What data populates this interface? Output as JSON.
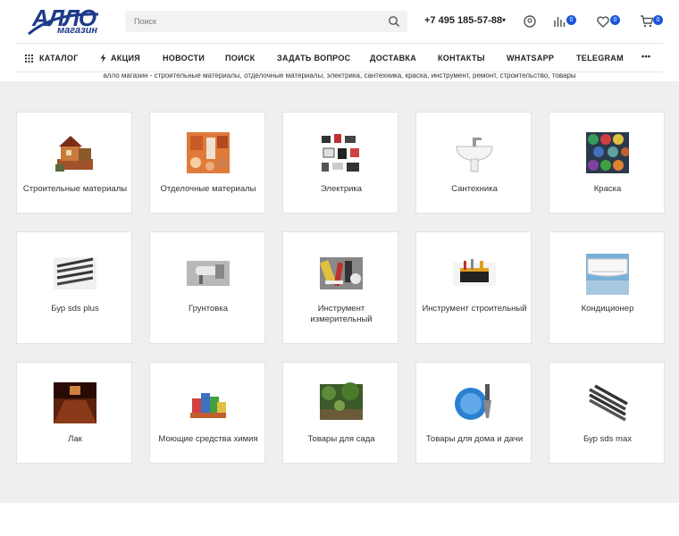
{
  "header": {
    "logo_main": "АЛЛО",
    "logo_sub": "магазин",
    "search_placeholder": "Поиск",
    "phone": "+7 495 185-57-88",
    "compare_count": "0",
    "favorites_count": "0",
    "cart_count": "0"
  },
  "nav": {
    "items": [
      "КАТАЛОГ",
      "АКЦИЯ",
      "НОВОСТИ",
      "ПОИСК",
      "ЗАДАТЬ ВОПРОС",
      "ДОСТАВКА",
      "КОНТАКТЫ",
      "WHATSAPP",
      "TELEGRAM"
    ],
    "more": "•••"
  },
  "tagline": "алло магазин - строительные материалы, отделочные материалы, электрика, сантехника, краска, инструмент, ремонт, строительство, товары",
  "categories": [
    {
      "label": "Строительные материалы",
      "icon": "house-icon"
    },
    {
      "label": "Отделочные материалы",
      "icon": "tiles-icon"
    },
    {
      "label": "Электрика",
      "icon": "electrical-icon"
    },
    {
      "label": "Сантехника",
      "icon": "sink-icon"
    },
    {
      "label": "Краска",
      "icon": "paint-cans-icon"
    },
    {
      "label": "Бур sds plus",
      "icon": "drill-bits-icon"
    },
    {
      "label": "Грунтовка",
      "icon": "primer-icon"
    },
    {
      "label": "Инструмент измерительный",
      "icon": "measuring-tools-icon"
    },
    {
      "label": "Инструмент строительный",
      "icon": "tool-bag-icon"
    },
    {
      "label": "Кондиционер",
      "icon": "air-conditioner-icon"
    },
    {
      "label": "Лак",
      "icon": "varnish-floor-icon"
    },
    {
      "label": "Моющие средства химия",
      "icon": "detergents-icon"
    },
    {
      "label": "Товары для сада",
      "icon": "garden-icon"
    },
    {
      "label": "Товары для дома и дачи",
      "icon": "dishes-icon"
    },
    {
      "label": "Бур sds max",
      "icon": "drill-bits-max-icon"
    }
  ],
  "colors": {
    "brand": "#1e3a8a",
    "badge": "#1a56db",
    "background": "#efefef"
  }
}
